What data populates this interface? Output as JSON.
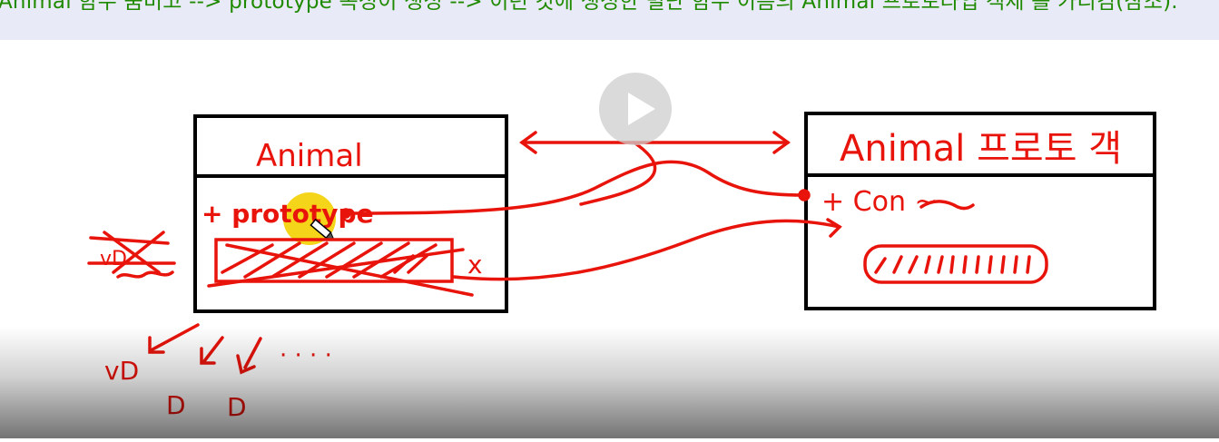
{
  "caption": {
    "text": "Animal 함수 줌비고 --> prototype 속성이 생성 --> 이런 것에 생성한 별난 함수 이름의 Animal 프로토타입 객체 를 가리킴(참조)."
  },
  "player": {
    "play_button": "play"
  },
  "diagram": {
    "left_box": {
      "title": "Animal",
      "property": "+ prototype",
      "crossed_mark": "x"
    },
    "right_box": {
      "title": "Animal 프로토 객",
      "property": "+ Con ~"
    },
    "side_scribble": "vD",
    "instances": [
      "vD",
      "D",
      "D"
    ],
    "ellipsis": "· · · ·"
  },
  "colors": {
    "ink_red": "#e8140b",
    "caption_green": "#1f8a00",
    "caption_bg": "#e8ebf7",
    "cursor_highlight": "#f4d000"
  }
}
